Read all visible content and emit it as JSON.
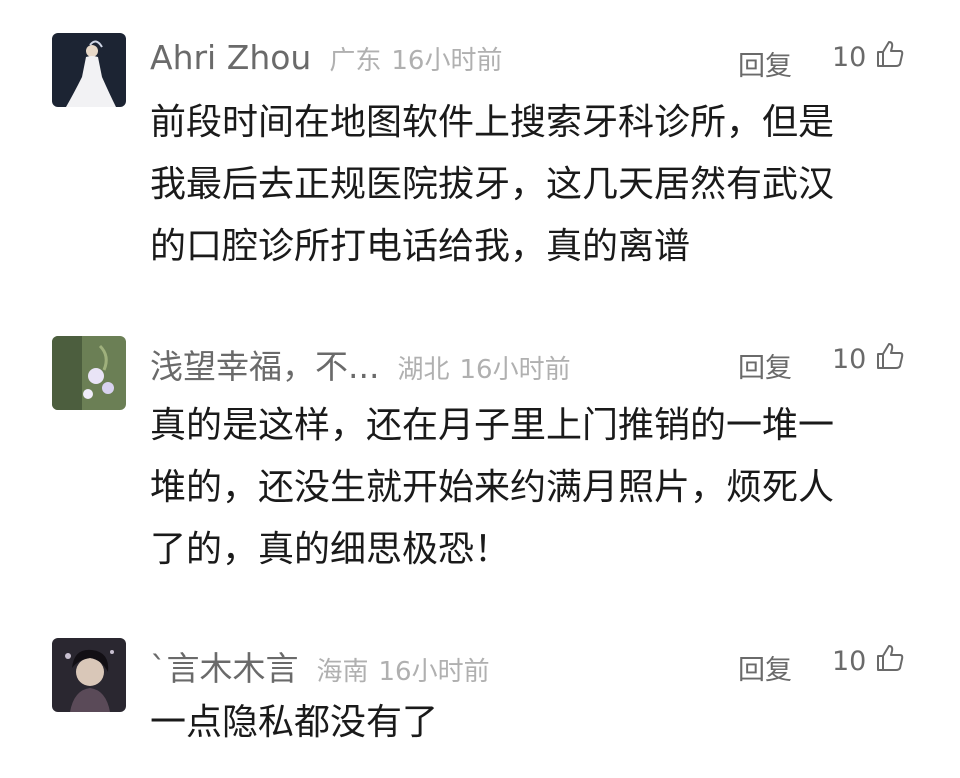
{
  "comments": [
    {
      "name": "Ahri Zhou",
      "location": "广东",
      "time": "16小时前",
      "reply_label": "回复",
      "likes": "10",
      "text_lines": [
        "前段时间在地图软件上搜索牙科诊所，但是",
        "我最后去正规医院拔牙，这几天居然有武汉",
        "的口腔诊所打电话给我，真的离谱"
      ]
    },
    {
      "name": "浅望幸福，不...",
      "location": "湖北",
      "time": "16小时前",
      "reply_label": "回复",
      "likes": "10",
      "text_lines": [
        "真的是这样，还在月子里上门推销的一堆一",
        "堆的，还没生就开始来约满月照片，烦死人",
        "了的，真的细思极恐！"
      ]
    },
    {
      "name": "`言木木言",
      "location": "海南",
      "time": "16小时前",
      "reply_label": "回复",
      "likes": "10",
      "text_lines": [
        "一点隐私都没有了"
      ]
    }
  ],
  "icons": {
    "like": "thumbs-up-outline-icon"
  },
  "colors": {
    "name": "#6a6a6a",
    "meta": "#b0b0b0",
    "body": "#1a1a1a"
  }
}
